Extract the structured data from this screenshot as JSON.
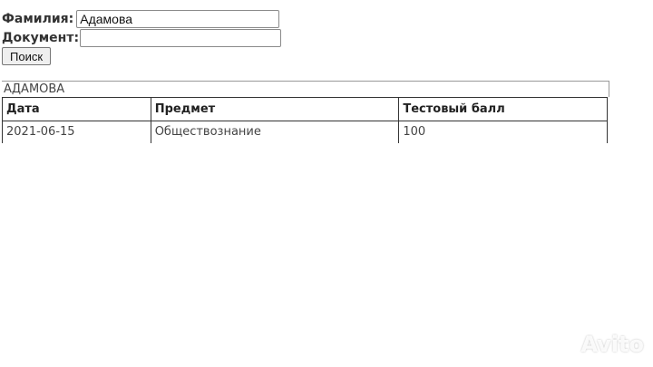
{
  "search_form": {
    "surname_label": "Фамилия:",
    "surname_value": "Адамова",
    "document_label": "Документ:",
    "document_value": "",
    "search_button_label": "Поиск"
  },
  "result": {
    "name": "АДАМОВА",
    "table": {
      "headers": [
        "Дата",
        "Предмет",
        "Тестовый балл"
      ],
      "rows": [
        [
          "2021-06-15",
          "Обществознание",
          "100"
        ]
      ]
    }
  },
  "watermark": {
    "text": "Avito"
  }
}
